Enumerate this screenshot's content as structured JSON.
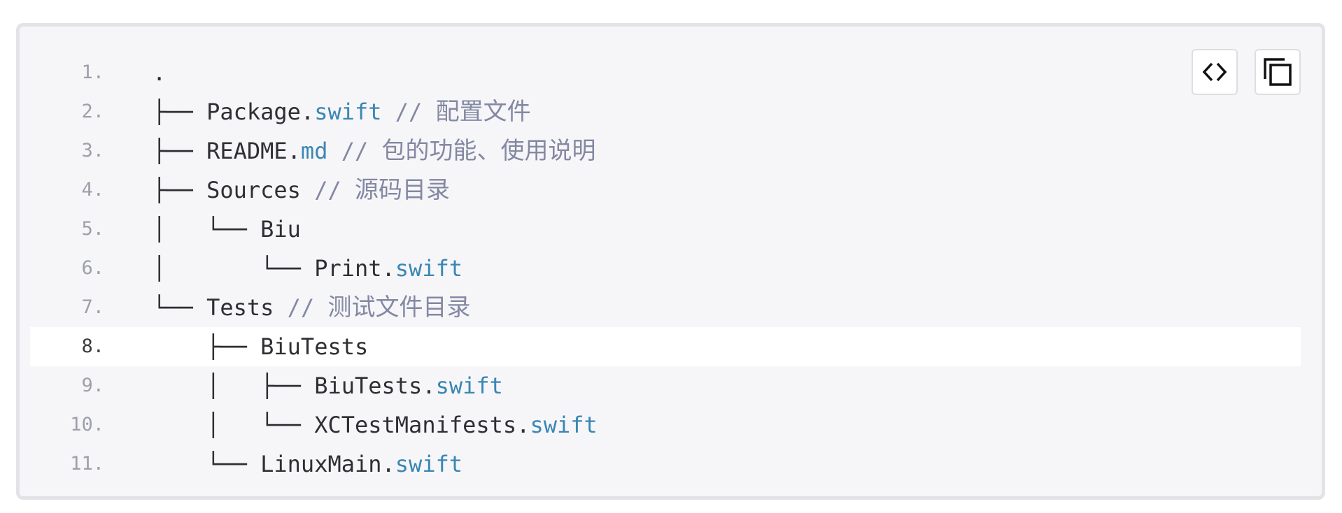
{
  "code_block": {
    "lines": [
      {
        "number": "1.",
        "tree": ".",
        "name": "",
        "ext": "",
        "comment": "",
        "active": false
      },
      {
        "number": "2.",
        "tree": "├── ",
        "name": "Package.",
        "ext": "swift",
        "comment": " // 配置文件",
        "active": false
      },
      {
        "number": "3.",
        "tree": "├── ",
        "name": "README.",
        "ext": "md",
        "comment": " // 包的功能、使用说明",
        "active": false
      },
      {
        "number": "4.",
        "tree": "├── ",
        "name": "Sources",
        "ext": "",
        "comment": " // 源码目录",
        "active": false
      },
      {
        "number": "5.",
        "tree": "│   └── ",
        "name": "Biu",
        "ext": "",
        "comment": "",
        "active": false
      },
      {
        "number": "6.",
        "tree": "│       └── ",
        "name": "Print.",
        "ext": "swift",
        "comment": "",
        "active": false
      },
      {
        "number": "7.",
        "tree": "└── ",
        "name": "Tests",
        "ext": "",
        "comment": " // 测试文件目录",
        "active": false
      },
      {
        "number": "8.",
        "tree": "    ├── ",
        "name": "BiuTests",
        "ext": "",
        "comment": "",
        "active": true
      },
      {
        "number": "9.",
        "tree": "    │   ├── ",
        "name": "BiuTests.",
        "ext": "swift",
        "comment": "",
        "active": false
      },
      {
        "number": "10.",
        "tree": "    │   └── ",
        "name": "XCTestManifests.",
        "ext": "swift",
        "comment": "",
        "active": false
      },
      {
        "number": "11.",
        "tree": "    └── ",
        "name": "LinuxMain.",
        "ext": "swift",
        "comment": "",
        "active": false
      }
    ]
  },
  "toolbar": {
    "view_source_icon": "code-brackets-icon",
    "copy_icon": "copy-icon"
  },
  "colors": {
    "background": "#f6f6f8",
    "border": "#e3e3e7",
    "extension": "#3a86b3",
    "comment": "#8388a3",
    "line_number": "#9da0a8"
  }
}
